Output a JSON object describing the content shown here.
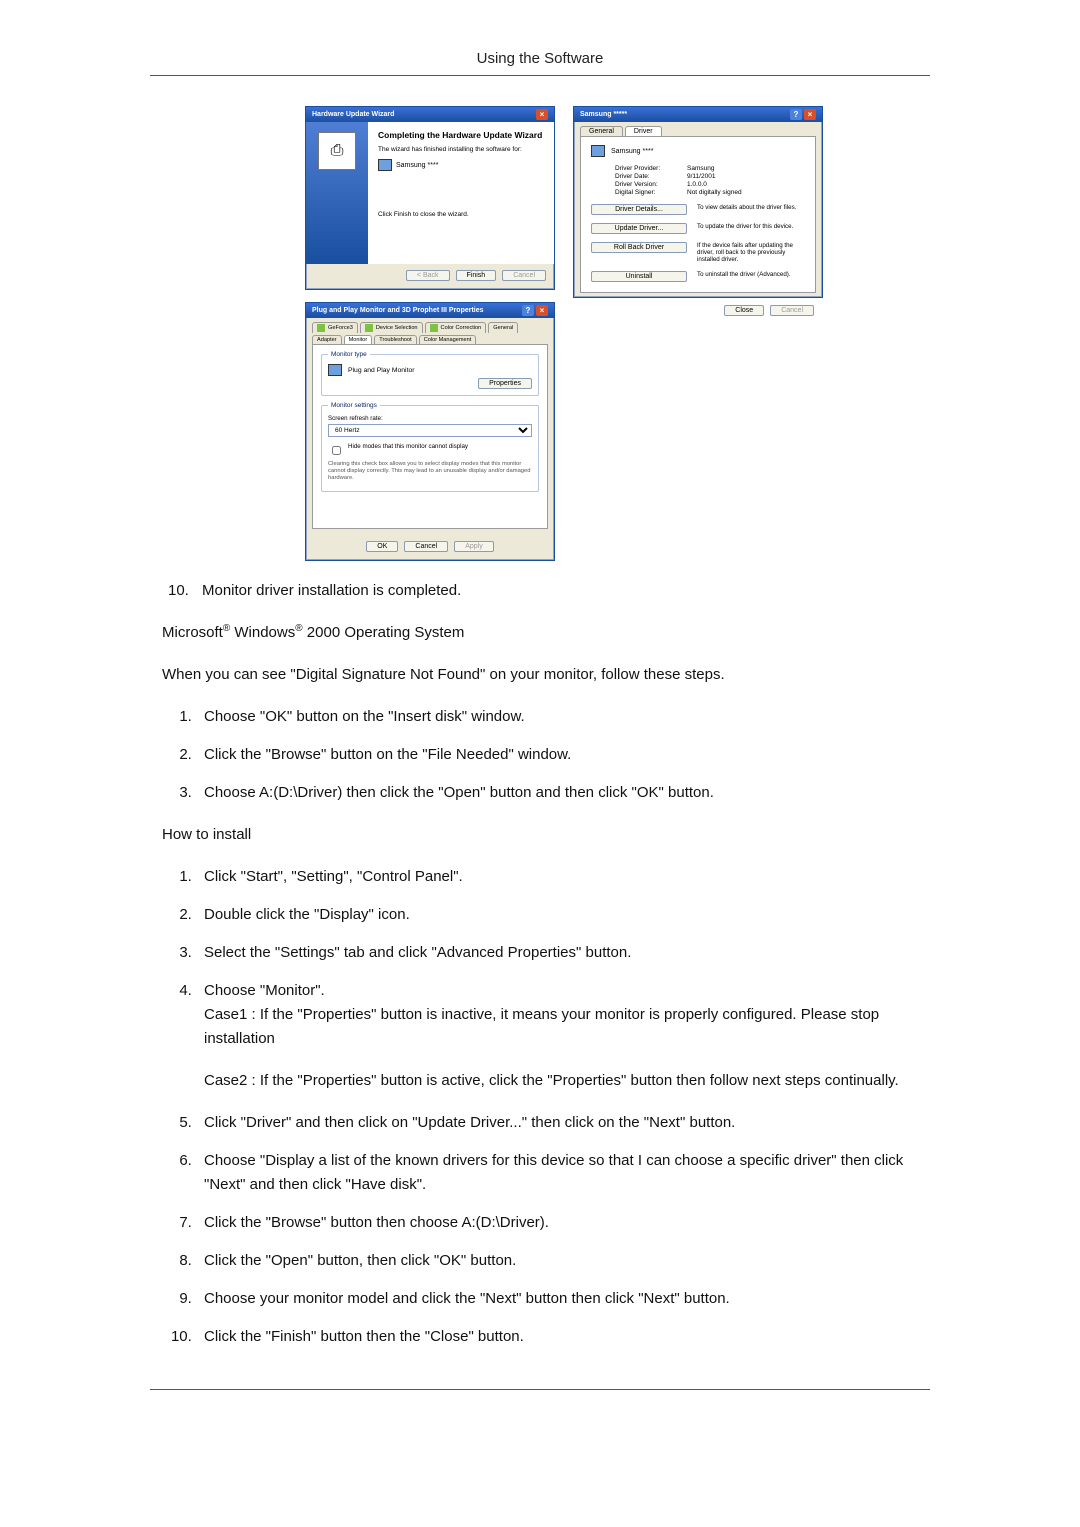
{
  "header": {
    "title": "Using the Software"
  },
  "wizard": {
    "titlebar": "Hardware Update Wizard",
    "heading": "Completing the Hardware Update Wizard",
    "line1": "The wizard has finished installing the software for:",
    "device": "Samsung ****",
    "finish_note": "Click Finish to close the wizard.",
    "buttons": {
      "back": "< Back",
      "finish": "Finish",
      "cancel": "Cancel"
    }
  },
  "driver": {
    "titlebar": "Samsung *****",
    "tabs": {
      "general": "General",
      "driver": "Driver"
    },
    "device_label": "Samsung ****",
    "provider_k": "Driver Provider:",
    "provider_v": "Samsung",
    "date_k": "Driver Date:",
    "date_v": "9/11/2001",
    "version_k": "Driver Version:",
    "version_v": "1.0.0.0",
    "signer_k": "Digital Signer:",
    "signer_v": "Not digitally signed",
    "btn_details": "Driver Details...",
    "desc_details": "To view details about the driver files.",
    "btn_update": "Update Driver...",
    "desc_update": "To update the driver for this device.",
    "btn_rollback": "Roll Back Driver",
    "desc_rollback": "If the device fails after updating the driver, roll back to the previously installed driver.",
    "btn_uninstall": "Uninstall",
    "desc_uninstall": "To uninstall the driver (Advanced).",
    "close": "Close",
    "cancel": "Cancel"
  },
  "mprop": {
    "titlebar": "Plug and Play Monitor and 3D Prophet III Properties",
    "tabs": {
      "geforce": "GeForce3",
      "devsel": "Device Selection",
      "colorcorr": "Color Correction",
      "general": "General",
      "adapter": "Adapter",
      "monitor": "Monitor",
      "trouble": "Troubleshoot",
      "colormgmt": "Color Management"
    },
    "monitor_type_legend": "Monitor type",
    "monitor_name": "Plug and Play Monitor",
    "properties_btn": "Properties",
    "monitor_settings_legend": "Monitor settings",
    "refresh_label": "Screen refresh rate:",
    "refresh_value": "60 Hertz",
    "hide_modes": "Hide modes that this monitor cannot display",
    "hint": "Clearing this check box allows you to select display modes that this monitor cannot display correctly. This may lead to an unusable display and/or damaged hardware.",
    "ok": "OK",
    "cancel": "Cancel",
    "apply": "Apply"
  },
  "body": {
    "pre_list": [
      {
        "n": "10.",
        "t": "Monitor driver installation is completed."
      }
    ],
    "os_line_prefix": "Microsoft",
    "os_line_mid": " Windows",
    "os_line_suffix": " 2000 Operating System",
    "dsnf": "When you can see \"Digital Signature Not Found\" on your monitor, follow these steps.",
    "steps_a": [
      "Choose \"OK\" button on the \"Insert disk\" window.",
      "Click the \"Browse\" button on the \"File Needed\" window.",
      "Choose A:(D:\\Driver) then click the \"Open\" button and then click \"OK\" button."
    ],
    "howto": "How to install",
    "steps_b": [
      "Click \"Start\", \"Setting\", \"Control Panel\".",
      "Double click the \"Display\" icon.",
      "Select the \"Settings\" tab and click \"Advanced Properties\" button.",
      "Choose \"Monitor\"."
    ],
    "case1": "Case1 : If the \"Properties\" button is inactive, it means your monitor is properly configured. Please stop installation",
    "case2": "Case2 : If the \"Properties\" button is active, click the \"Properties\" button then follow next steps continually.",
    "steps_c": [
      "Click \"Driver\" and then click on \"Update Driver...\" then click on the \"Next\" button.",
      "Choose \"Display a list of the known drivers for this device so that I can choose a specific driver\" then click \"Next\" and then click \"Have disk\".",
      "Click the \"Browse\" button then choose A:(D:\\Driver).",
      "Click the \"Open\" button, then click \"OK\" button.",
      "Choose your monitor model and click the \"Next\" button then click \"Next\" button.",
      "Click the \"Finish\" button then the \"Close\" button."
    ]
  }
}
